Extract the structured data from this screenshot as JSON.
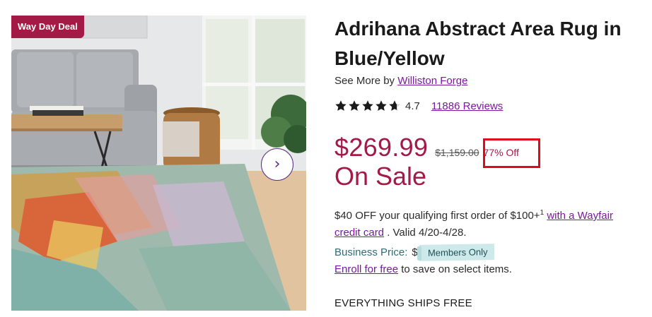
{
  "badge": {
    "label": "Way Day Deal"
  },
  "colors": {
    "brand": "#7b189f",
    "sale": "#a31a47",
    "highlight": "#e00a1b",
    "members_tag": "#cde9ea"
  },
  "gallery": {
    "next_icon": "chevron-right-icon",
    "next_glyph": "›"
  },
  "product": {
    "title": "Adrihana Abstract Area Rug in Blue/Yellow",
    "see_more_prefix": "See More by",
    "brand": "Williston Forge",
    "rating": "4.7",
    "stars": 4.7,
    "reviews": "11886 Reviews"
  },
  "pricing": {
    "sale_price": "$269.99",
    "original_price": "$1,159.00",
    "discount": "77% Off",
    "sale_label": "On Sale"
  },
  "offer": {
    "text1": "$40 OFF your qualifying first order of $100+",
    "footnote": "1",
    "link": "with a Wayfair credit card",
    "text2": ". Valid 4/20-4/28."
  },
  "business": {
    "label": "Business Price:",
    "dollar": "$",
    "members_tag": "Members Only",
    "enroll_link": "Enroll for free",
    "enroll_text": "to save on select items."
  },
  "shipping": {
    "text": "EVERYTHING SHIPS FREE"
  }
}
